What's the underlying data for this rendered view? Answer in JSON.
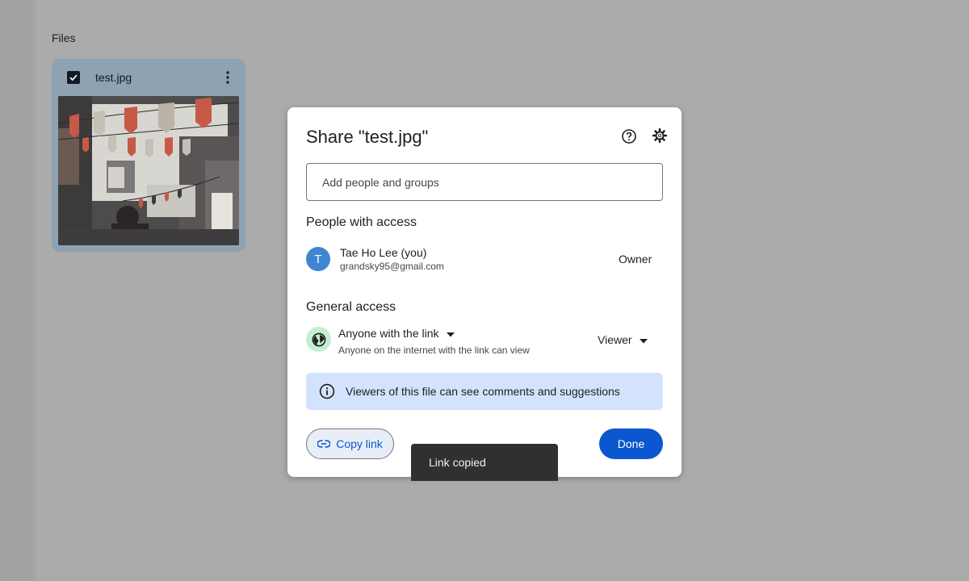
{
  "files_heading": "Files",
  "file": {
    "name": "test.jpg",
    "selected": true
  },
  "dialog": {
    "title": "Share \"test.jpg\"",
    "add_people_placeholder": "Add people and groups",
    "people_section": "People with access",
    "owner": {
      "initial": "T",
      "name": "Tae Ho Lee (you)",
      "email": "grandsky95@gmail.com",
      "role": "Owner",
      "avatar_color": "#3f86d1"
    },
    "general_section": "General access",
    "general_access": {
      "option": "Anyone with the link",
      "description": "Anyone on the internet with the link can view",
      "role": "Viewer"
    },
    "info_banner": "Viewers of this file can see comments and suggestions",
    "copy_link": "Copy link",
    "done": "Done"
  },
  "toast": "Link copied",
  "colors": {
    "accent": "#0b57d0",
    "banner": "#d3e3fd",
    "globe_bg": "#c4eed0",
    "overlay": "#ababab"
  },
  "icons": [
    "checkbox-checked-icon",
    "more-vert-icon",
    "help-icon",
    "settings-icon",
    "globe-icon",
    "dropdown-arrow-icon",
    "info-icon",
    "link-icon"
  ]
}
